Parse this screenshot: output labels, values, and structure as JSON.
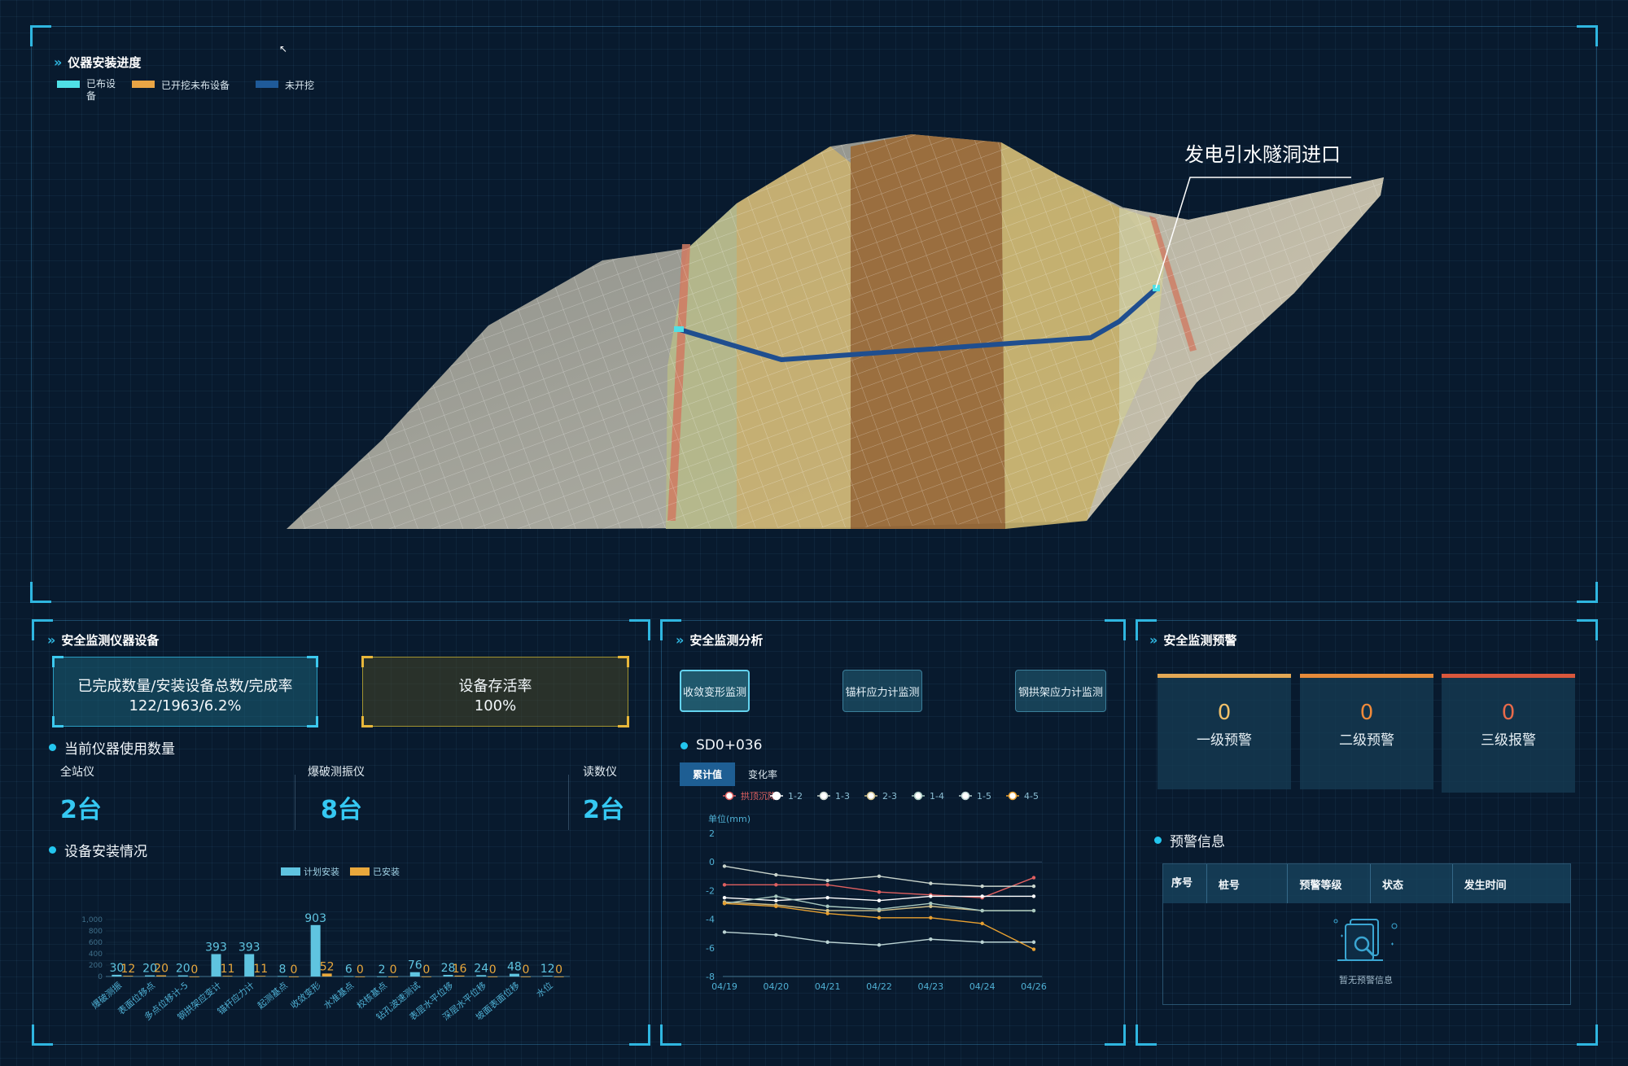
{
  "top_panel": {
    "title": "仪器安装进度",
    "legend": [
      {
        "label": "已布设备",
        "color": "#4fe0e6"
      },
      {
        "label": "已开挖未布设备",
        "color": "#e9a545"
      },
      {
        "label": "未开挖",
        "color": "#1f5a99"
      }
    ],
    "callout": "发电引水隧洞进口"
  },
  "left_panel": {
    "title": "安全监测仪器设备",
    "completion_label": "已完成数量/安装设备总数/完成率",
    "completion_value": "122/1963/6.2%",
    "survival_label": "设备存活率",
    "survival_value": "100%",
    "usage_title": "当前仪器使用数量",
    "instruments": [
      {
        "name": "全站仪",
        "value": "2台"
      },
      {
        "name": "爆破测振仪",
        "value": "8台"
      },
      {
        "name": "读数仪",
        "value": "2台"
      }
    ],
    "install_title": "设备安装情况"
  },
  "chart_data": [
    {
      "type": "bar",
      "legend": [
        "计划安装",
        "已安装"
      ],
      "categories": [
        "爆破测振",
        "表面位移点",
        "多点位移计-5",
        "钢拱架应变计",
        "锚杆应力计",
        "起测基点",
        "收敛变形",
        "水准基点",
        "校核基点",
        "钻孔波速测试",
        "表层水平位移",
        "深层水平位移",
        "坡面表面位移",
        "水位"
      ],
      "series": [
        {
          "name": "计划安装",
          "values": [
            30,
            20,
            20,
            393,
            393,
            8,
            903,
            6,
            2,
            76,
            28,
            24,
            48,
            12
          ],
          "color": "#5fc4e0"
        },
        {
          "name": "已安装",
          "values": [
            12,
            20,
            0,
            11,
            11,
            0,
            52,
            0,
            0,
            0,
            16,
            0,
            0,
            0
          ],
          "color": "#e9a83c"
        }
      ],
      "yticks": [
        "0",
        "200",
        "400",
        "600",
        "800",
        "1,000"
      ],
      "ylim": [
        0,
        1000
      ]
    },
    {
      "type": "line",
      "section": "SD0+036",
      "toggle": [
        "累计值",
        "变化率"
      ],
      "ylabel": "单位(mm)",
      "x": [
        "04/19",
        "04/20",
        "04/21",
        "04/22",
        "04/23",
        "04/24",
        "04/26"
      ],
      "ylim": [
        -8,
        2
      ],
      "yticks": [
        "2",
        "0",
        "-2",
        "-4",
        "-6",
        "-8"
      ],
      "series": [
        {
          "name": "拱顶沉降",
          "color": "#e06060",
          "values": [
            -1.6,
            -1.6,
            -1.6,
            -2.1,
            -2.3,
            -2.5,
            -1.1
          ]
        },
        {
          "name": "1-2",
          "color": "#ffffff",
          "values": [
            -2.5,
            -2.7,
            -2.5,
            -2.7,
            -2.4,
            -2.4,
            -2.4
          ]
        },
        {
          "name": "1-3",
          "color": "#c9d4cc",
          "values": [
            -0.3,
            -0.9,
            -1.3,
            -1.0,
            -1.5,
            -1.7,
            -1.7
          ]
        },
        {
          "name": "2-3",
          "color": "#d0c08a",
          "values": [
            -2.8,
            -3.0,
            -3.4,
            -3.4,
            -3.1,
            -3.4,
            -3.4
          ]
        },
        {
          "name": "1-4",
          "color": "#a9c9c0",
          "values": [
            -2.9,
            -2.4,
            -3.1,
            -3.3,
            -2.9,
            -3.4,
            -3.4
          ]
        },
        {
          "name": "1-5",
          "color": "#bcd4d4",
          "values": [
            -4.9,
            -5.1,
            -5.6,
            -5.8,
            -5.4,
            -5.6,
            -5.6
          ]
        },
        {
          "name": "4-5",
          "color": "#e8a030",
          "values": [
            -2.9,
            -3.1,
            -3.6,
            -3.9,
            -3.9,
            -4.3,
            -6.1
          ]
        }
      ]
    }
  ],
  "middle_panel": {
    "title": "安全监测分析",
    "tabs": [
      "收敛变形监测",
      "锚杆应力计监测",
      "钢拱架应力计监测"
    ]
  },
  "right_panel": {
    "title": "安全监测预警",
    "cards": [
      {
        "value": "0",
        "label": "一级预警",
        "bar": "#e3a855",
        "num_color": "#f0c06a"
      },
      {
        "value": "0",
        "label": "二级预警",
        "bar": "#e68a3a",
        "num_color": "#f08a3a"
      },
      {
        "value": "0",
        "label": "三级报警",
        "bar": "#d9573c",
        "num_color": "#e86a4a"
      }
    ],
    "info_title": "预警信息",
    "table_headers": [
      "序号",
      "桩号",
      "预警等级",
      "状态",
      "发生时间"
    ],
    "empty": "暂无预警信息"
  }
}
